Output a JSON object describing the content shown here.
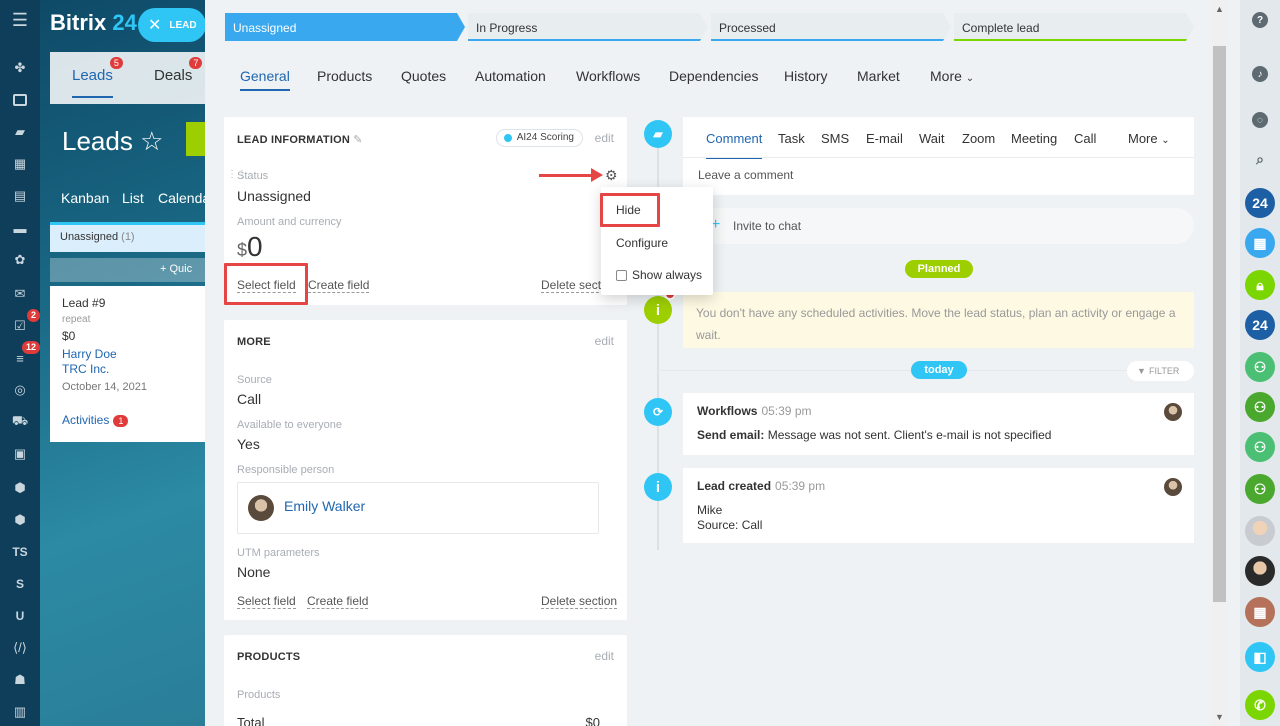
{
  "app": {
    "logo_text": "Bitrix",
    "logo_num": "24",
    "lead_pill": "LEAD"
  },
  "left_rail": {
    "badges": [
      "2",
      "12"
    ],
    "labels": [
      "TS",
      "S",
      "U"
    ]
  },
  "background": {
    "tabs": [
      {
        "label": "Leads",
        "badge": "5"
      },
      {
        "label": "Deals",
        "badge": "7"
      }
    ],
    "title": "Leads",
    "views": [
      "Kanban",
      "List",
      "Calenda"
    ],
    "column": {
      "name": "Unassigned",
      "count": "(1)"
    },
    "quick": "+ Quic",
    "card": {
      "title": "Lead #9",
      "sub": "repeat",
      "amount": "$0",
      "contact": "Harry Doe",
      "company": "TRC Inc.",
      "date": "October 14, 2021",
      "activities": "Activities",
      "activities_badge": "1"
    }
  },
  "stages": [
    "Unassigned",
    "In Progress",
    "Processed",
    "Complete lead"
  ],
  "main_tabs": [
    "General",
    "Products",
    "Quotes",
    "Automation",
    "Workflows",
    "Dependencies",
    "History",
    "Market",
    "More"
  ],
  "lead_info": {
    "title": "LEAD INFORMATION",
    "ai_badge": "AI24 Scoring",
    "edit": "edit",
    "status_label": "Status",
    "status_value": "Unassigned",
    "amount_label": "Amount and currency",
    "currency": "$",
    "amount": "0",
    "select_field": "Select field",
    "create_field": "Create field",
    "delete_section": "Delete secti"
  },
  "dropdown": {
    "hide": "Hide",
    "configure": "Configure",
    "show_always": "Show always"
  },
  "more_section": {
    "title": "MORE",
    "edit": "edit",
    "source_label": "Source",
    "source_value": "Call",
    "available_label": "Available to everyone",
    "available_value": "Yes",
    "responsible_label": "Responsible person",
    "responsible_name": "Emily Walker",
    "utm_label": "UTM parameters",
    "utm_value": "None",
    "select_field": "Select field",
    "create_field": "Create field",
    "delete_section": "Delete section"
  },
  "products_section": {
    "title": "PRODUCTS",
    "edit": "edit",
    "label": "Products",
    "total_label": "Total",
    "total_value": "$0"
  },
  "editor": {
    "tabs": [
      "Comment",
      "Task",
      "SMS",
      "E-mail",
      "Wait",
      "Zoom",
      "Meeting",
      "Call",
      "More"
    ],
    "placeholder": "Leave a comment"
  },
  "invite": "Invite to chat",
  "planned": "Planned",
  "warning": "You don't have any scheduled activities. Move the lead status, plan an activity or engage a wait.",
  "today": "today",
  "filter": "FILTER",
  "events": [
    {
      "title": "Workflows",
      "time": "05:39 pm",
      "bold": "Send email:",
      "text": " Message was not sent. Client's e-mail is not specified"
    },
    {
      "title": "Lead created",
      "time": "05:39 pm",
      "line1": "Mike",
      "line2": "Source: Call"
    }
  ],
  "right_rail": {
    "labels": [
      "24",
      "24"
    ]
  },
  "colors": {
    "accent": "#2067b0",
    "stage_active": "#39a8ef",
    "green": "#7bd500",
    "red": "#e64545"
  }
}
